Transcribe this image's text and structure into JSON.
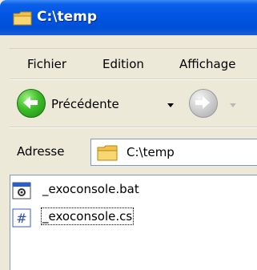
{
  "window": {
    "title": "C:\\temp",
    "icon": "folder-icon"
  },
  "menu": {
    "items": [
      "Fichier",
      "Edition",
      "Affichage"
    ]
  },
  "toolbar": {
    "back_label": "Précédente",
    "back_icon": "back-arrow-icon",
    "forward_icon": "forward-arrow-icon"
  },
  "address": {
    "label": "Adresse",
    "value": "C:\\temp",
    "icon": "folder-icon"
  },
  "files": [
    {
      "name": "_exoconsole.bat",
      "icon": "batch-file-icon"
    },
    {
      "name": "_exoconsole.cs",
      "icon": "csharp-file-icon"
    }
  ],
  "colors": {
    "titlebar": "#0054e3",
    "chrome": "#ece9d8",
    "back_button": "#3dbe2a",
    "forward_button": "#c9c9c9"
  }
}
